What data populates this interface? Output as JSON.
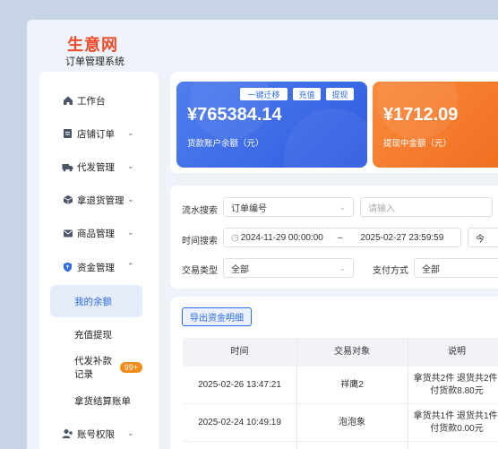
{
  "brand": {
    "logo_text": "生意网",
    "subtitle": "订单管理系统"
  },
  "sidebar": {
    "items": [
      {
        "label": "工作台",
        "icon": "home-icon"
      },
      {
        "label": "店铺订单",
        "icon": "document-icon",
        "chevron": "⌄"
      },
      {
        "label": "代发管理",
        "icon": "truck-icon",
        "chevron": "⌄"
      },
      {
        "label": "拿退货管理",
        "icon": "box-icon",
        "chevron": "⌄"
      },
      {
        "label": "商品管理",
        "icon": "mail-icon",
        "chevron": "⌄"
      },
      {
        "label": "资金管理",
        "icon": "shield-icon",
        "chevron": "⌃"
      }
    ],
    "sub_items": [
      {
        "label": "我的余额"
      },
      {
        "label": "充值提现"
      },
      {
        "label": "代发补款记录",
        "badge": "99+"
      },
      {
        "label": "拿货结算账单"
      }
    ],
    "last_item": {
      "label": "账号权限",
      "icon": "user-icon",
      "chevron": "⌄"
    }
  },
  "cards": {
    "balance": {
      "amount": "¥765384.14",
      "label": "货款账户余额（元）",
      "btn_migrate": "一键迁移",
      "btn_recharge": "充值",
      "btn_withdraw": "提现"
    },
    "withdrawing": {
      "amount": "¥1712.09",
      "label": "提现中金额（元）"
    }
  },
  "filters": {
    "search_label": "流水搜索",
    "search_type": "订单编号",
    "search_placeholder": "请输入",
    "time_label": "时间搜索",
    "time_start": "2024-11-29 00:00:00",
    "time_sep": "–",
    "time_end": "2025-02-27 23:59:59",
    "today_label": "今",
    "trade_type_label": "交易类型",
    "trade_type_value": "全部",
    "pay_method_label": "支付方式",
    "pay_method_value": "全部"
  },
  "table": {
    "export_label": "导出资金明细",
    "headers": [
      "时间",
      "交易对象",
      "说明"
    ],
    "rows": [
      {
        "time": "2025-02-26 13:47:21",
        "object": "祥鹰2",
        "desc_line1": "拿货共2件 退货共2件,",
        "desc_line2": "付货款8.80元"
      },
      {
        "time": "2025-02-24 10:49:19",
        "object": "泡泡象",
        "desc_line1": "拿货共1件 退货共1件,",
        "desc_line2": "付货款0.00元"
      }
    ]
  },
  "colors": {
    "accent": "#2d6be4",
    "blue_card": "#3a66e6",
    "orange_card": "#f47a2c",
    "badge": "#f28b1a",
    "logo": "#f04a2a"
  }
}
